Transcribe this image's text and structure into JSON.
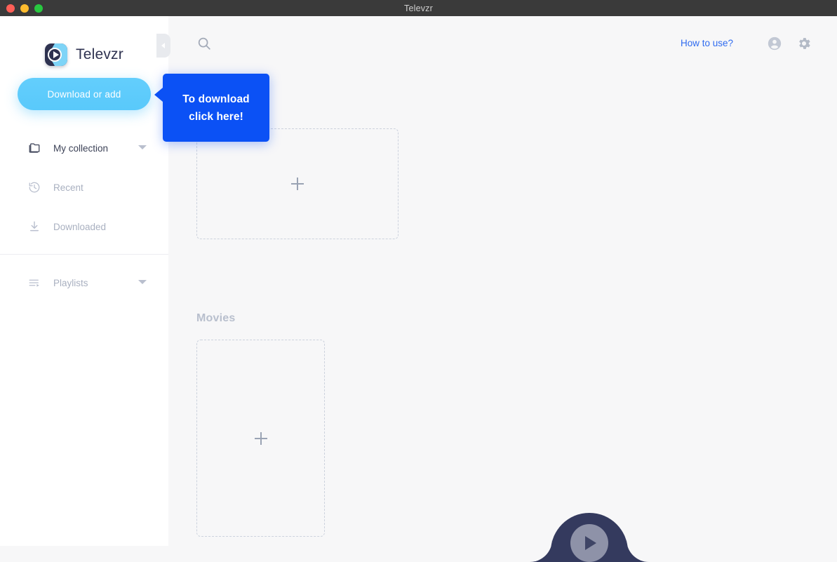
{
  "window": {
    "title": "Televzr",
    "traffic_lights": [
      "close",
      "minimize",
      "zoom"
    ]
  },
  "sidebar": {
    "brand": "Televzr",
    "logo_icon": "televzr-play-logo-icon",
    "download_button": "Download or add",
    "collapse_handle_icon": "chevron-left-icon",
    "items": [
      {
        "label": "My collection",
        "icon": "folder-icon",
        "state": "active",
        "has_caret": true
      },
      {
        "label": "Recent",
        "icon": "history-icon",
        "state": "muted",
        "has_caret": false
      },
      {
        "label": "Downloaded",
        "icon": "download-icon",
        "state": "muted",
        "has_caret": false
      },
      {
        "label": "Playlists",
        "icon": "playlist-icon",
        "state": "muted",
        "has_caret": true
      }
    ]
  },
  "topbar": {
    "search_icon": "search-icon",
    "how_to_use": "How to use?",
    "account_icon": "account-circle-icon",
    "settings_icon": "gear-icon"
  },
  "main": {
    "dropzones": [
      {
        "name": "top-dropzone",
        "plus_icon": "plus-icon"
      },
      {
        "name": "movies-dropzone",
        "plus_icon": "plus-icon"
      }
    ],
    "sections": [
      {
        "title": "Movies"
      }
    ]
  },
  "tooltip": {
    "line1": "To download",
    "line2": "click here!",
    "color": "#0b51f5"
  },
  "player": {
    "play_icon": "play-icon"
  },
  "colors": {
    "accent_blue": "#0b51f5",
    "link_blue": "#2f6bf0",
    "button_sky": "#5ecffa",
    "brand_navy": "#2e3250",
    "page_bg": "#f7f7f8",
    "sidebar_bg": "#ffffff",
    "titlebar_bg": "#3a3a3a"
  }
}
